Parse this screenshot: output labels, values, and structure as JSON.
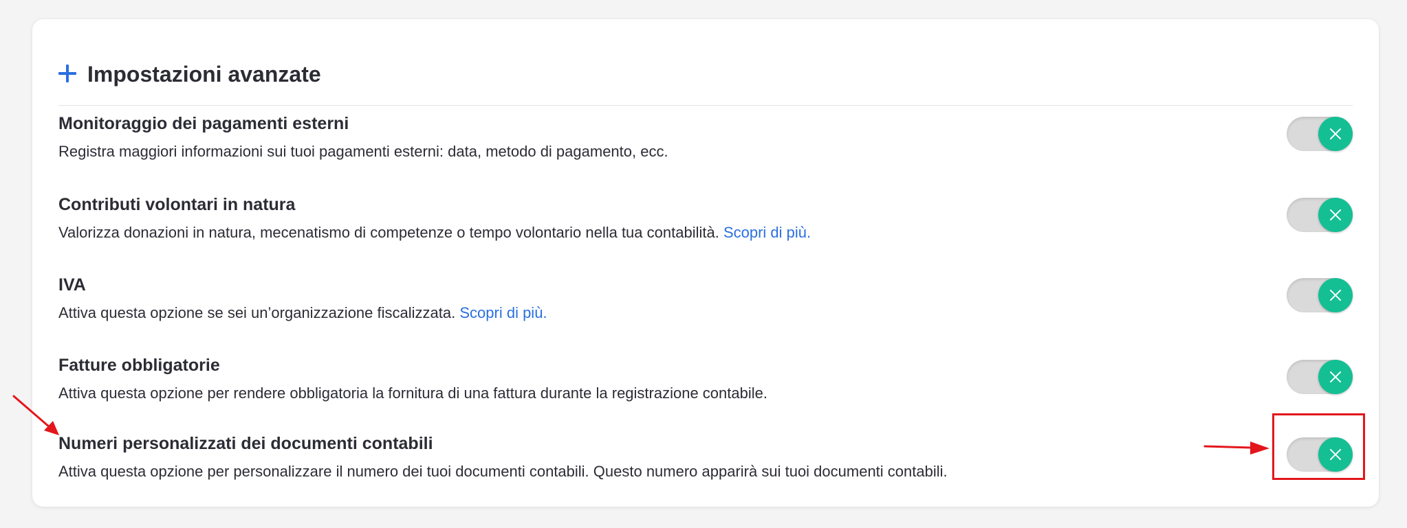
{
  "panel": {
    "title": "Impostazioni avanzate",
    "expand_icon": "plus-icon"
  },
  "settings": [
    {
      "title": "Monitoraggio dei pagamenti esterni",
      "description": "Registra maggiori informazioni sui tuoi pagamenti esterni: data, metodo di pagamento, ecc.",
      "link": "",
      "enabled": true
    },
    {
      "title": "Contributi volontari in natura",
      "description": "Valorizza donazioni in natura, mecenatismo di competenze o tempo volontario nella tua contabilità.",
      "link": "Scopri di più.",
      "enabled": true
    },
    {
      "title": "IVA",
      "description": "Attiva questa opzione se sei un’organizzazione fiscalizzata.",
      "link": "Scopri di più.",
      "enabled": true
    },
    {
      "title": "Fatture obbligatorie",
      "description": "Attiva questa opzione per rendere obbligatoria la fornitura di una fattura durante la registrazione contabile.",
      "link": "",
      "enabled": true
    },
    {
      "title": "Numeri personalizzati dei documenti contabili",
      "description": "Attiva questa opzione per personalizzare il numero dei tuoi documenti contabili. Questo numero apparirà sui tuoi documenti contabili.",
      "link": "",
      "enabled": true
    }
  ],
  "toggle_icon": "close-icon",
  "colors": {
    "accent": "#2a6fe0",
    "toggle_on": "#14bf94",
    "toggle_track": "#dadada",
    "annotation": "#e3161c"
  }
}
